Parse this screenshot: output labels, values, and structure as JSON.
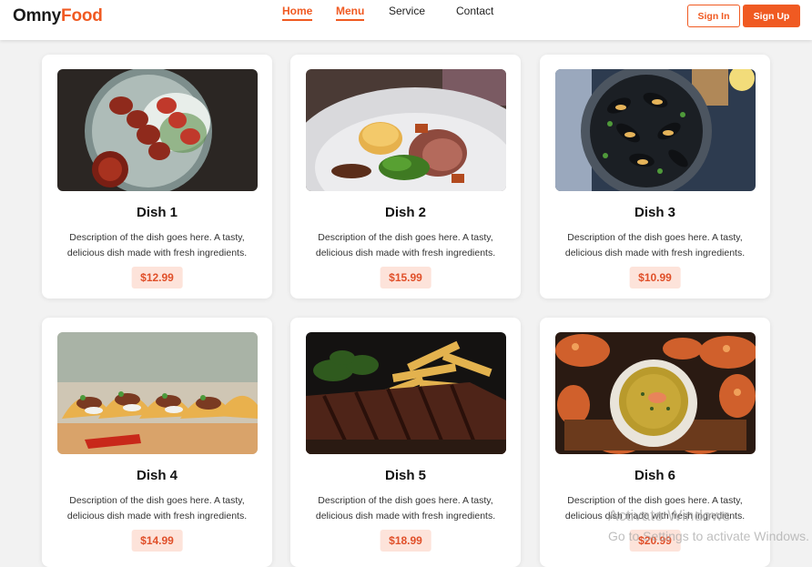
{
  "brand": {
    "part1": "Omny",
    "part2": "Food"
  },
  "nav": {
    "home": "Home",
    "menu": "Menu",
    "service": "Service",
    "contact": "Contact"
  },
  "actions": {
    "sign_in": "Sign In",
    "sign_up": "Sign Up"
  },
  "dishes": [
    {
      "title": "Dish 1",
      "description": "Description of the dish goes here. A tasty, delicious dish made with fresh ingredients.",
      "price": "$12.99",
      "image": "skewers-on-rice"
    },
    {
      "title": "Dish 2",
      "description": "Description of the dish goes here. A tasty, delicious dish made with fresh ingredients.",
      "price": "$15.99",
      "image": "plated-steak-broccoli"
    },
    {
      "title": "Dish 3",
      "description": "Description of the dish goes here. A tasty, delicious dish made with fresh ingredients.",
      "price": "$10.99",
      "image": "mussels-pot"
    },
    {
      "title": "Dish 4",
      "description": "Description of the dish goes here. A tasty, delicious dish made with fresh ingredients.",
      "price": "$14.99",
      "image": "tacos"
    },
    {
      "title": "Dish 5",
      "description": "Description of the dish goes here. A tasty, delicious dish made with fresh ingredients.",
      "price": "$18.99",
      "image": "grilled-steak-fries"
    },
    {
      "title": "Dish 6",
      "description": "Description of the dish goes here. A tasty, delicious dish made with fresh ingredients.",
      "price": "$20.99",
      "image": "soup-with-crab"
    }
  ],
  "colors": {
    "accent": "#f05a22",
    "price_bg": "#fde3da",
    "price_text": "#e0502a",
    "page_bg": "#f2f2f2"
  },
  "watermark": {
    "line1": "Activate Windows",
    "line2": "Go to Settings to activate Windows."
  }
}
